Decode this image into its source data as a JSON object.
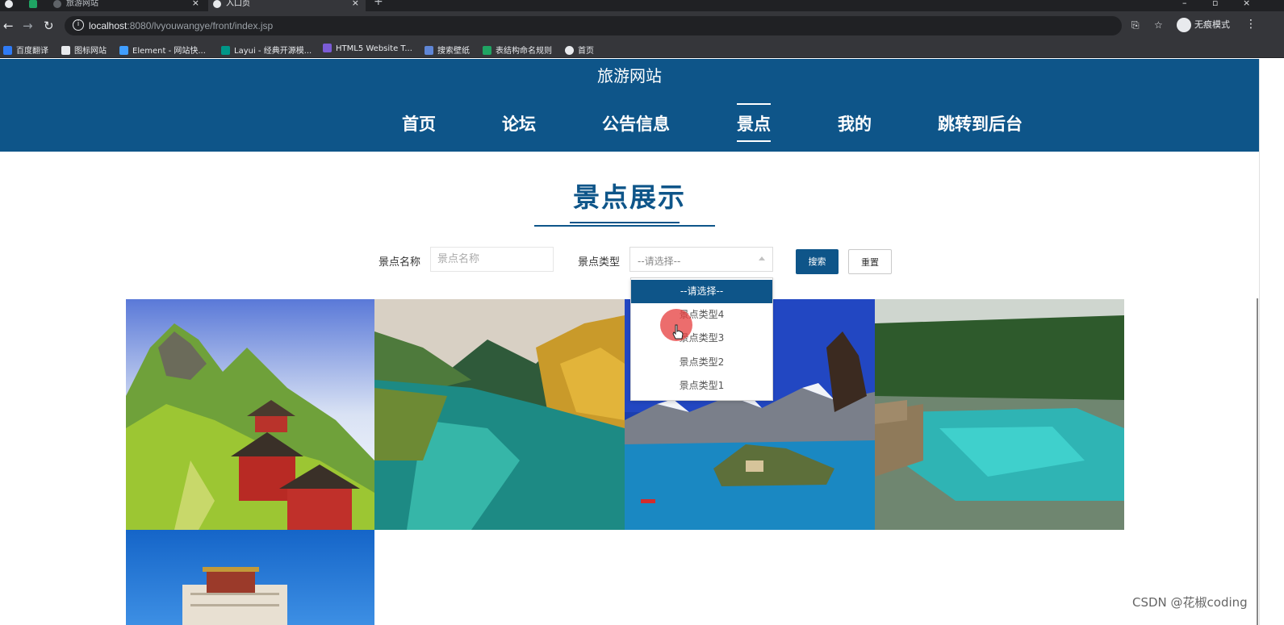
{
  "browser": {
    "tabs": [
      {
        "title": "旅游网站",
        "active": false
      },
      {
        "title": "入口页",
        "active": true
      }
    ],
    "new_tab": "+",
    "url_host": "localhost",
    "url_rest": ":8080/lvyouwangye/front/index.jsp",
    "incognito_label": "无痕模式",
    "bookmarks": [
      {
        "label": "百度翻译",
        "color": "#2f7bf5"
      },
      {
        "label": "图标网站",
        "color": "#e8eaed"
      },
      {
        "label": "Element - 网站快...",
        "color": "#409eff"
      },
      {
        "label": "Layui - 经典开源模...",
        "color": "#009688"
      },
      {
        "label": "HTML5 Website T...",
        "color": "#7b5cd6"
      },
      {
        "label": "搜索壁纸",
        "color": "#5f86d6"
      },
      {
        "label": "表结构命名规则",
        "color": "#1fa463"
      },
      {
        "label": "首页",
        "color": "#e8eaed"
      }
    ]
  },
  "header": {
    "site_title": "旅游网站",
    "nav": [
      {
        "label": "首页",
        "active": false
      },
      {
        "label": "论坛",
        "active": false
      },
      {
        "label": "公告信息",
        "active": false
      },
      {
        "label": "景点",
        "active": true
      },
      {
        "label": "我的",
        "active": false
      },
      {
        "label": "跳转到后台",
        "active": false
      }
    ]
  },
  "section": {
    "title": "景点展示"
  },
  "filter": {
    "name_label": "景点名称",
    "name_placeholder": "景点名称",
    "name_value": "",
    "type_label": "景点类型",
    "type_selected": "--请选择--",
    "type_options": [
      "--请选择--",
      "景点类型4",
      "景点类型3",
      "景点类型2",
      "景点类型1"
    ],
    "search_label": "搜索",
    "reset_label": "重置"
  },
  "attractions": [
    {
      "name": "mountain-temple-photo"
    },
    {
      "name": "autumn-lake-photo"
    },
    {
      "name": "snow-mountain-island-photo"
    },
    {
      "name": "turquoise-pool-photo"
    },
    {
      "name": "palace-photo"
    }
  ],
  "colors": {
    "brand": "#0e5589",
    "header_bg": "#0e5589"
  },
  "watermark": "CSDN @花椒coding"
}
